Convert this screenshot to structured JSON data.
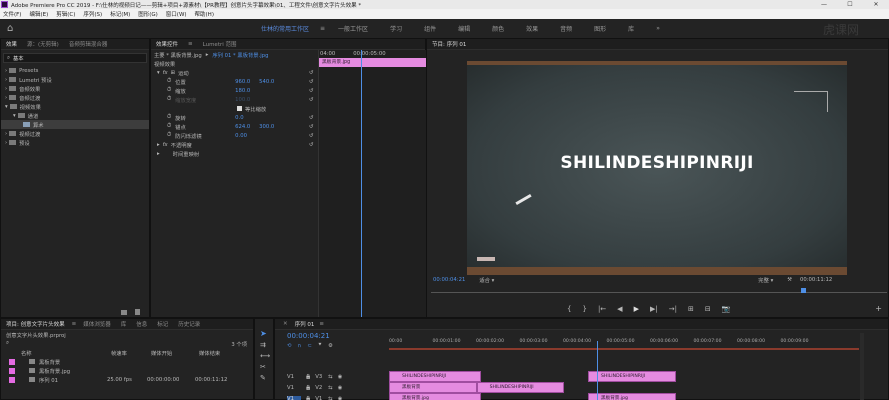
{
  "app": {
    "title": "Adobe Premiere Pro CC 2019 - F:\\仕林的视频日记——剪辑+项目+源素材\\【PR教程】创意片头字幕效果\\01、工程文件\\创意文字片头效果 *",
    "window_buttons": [
      "—",
      "☐",
      "✕"
    ]
  },
  "menu": [
    "文件(F)",
    "编辑(E)",
    "剪辑(C)",
    "序列(S)",
    "标记(M)",
    "图形(G)",
    "窗口(W)",
    "帮助(H)"
  ],
  "workspaces": [
    "仕林的常用工作区",
    "≡",
    "一般工作区",
    "学习",
    "组件",
    "编辑",
    "颜色",
    "效果",
    "音频",
    "图形",
    "库",
    "»"
  ],
  "effects_panel": {
    "tabs": [
      "效果",
      "源：(无剪辑)",
      "音频剪辑混合器"
    ],
    "search_value": "基本",
    "tree": [
      {
        "label": "Presets",
        "indent": 0,
        "icon": "folder",
        "selected": false
      },
      {
        "label": "Lumetri 预设",
        "indent": 0,
        "icon": "folder",
        "selected": false
      },
      {
        "label": "音频效果",
        "indent": 0,
        "icon": "folder",
        "selected": false
      },
      {
        "label": "音频过渡",
        "indent": 0,
        "icon": "folder",
        "selected": false
      },
      {
        "label": "视频效果",
        "indent": 0,
        "icon": "folder",
        "selected": false,
        "open": true
      },
      {
        "label": "通道",
        "indent": 1,
        "icon": "folder",
        "selected": false,
        "open": true
      },
      {
        "label": "算术",
        "indent": 2,
        "icon": "fx",
        "selected": true
      },
      {
        "label": "视频过渡",
        "indent": 0,
        "icon": "folder",
        "selected": false
      },
      {
        "label": "预设",
        "indent": 0,
        "icon": "folder",
        "selected": false
      }
    ]
  },
  "effect_controls": {
    "tabs": [
      "效果控件",
      "≡",
      "Lumetri 范围"
    ],
    "breadcrumb_master": "主要 * 黑板背景.jpg",
    "breadcrumb_seq": "序列 01 * 黑板背景.jpg",
    "mini_clip": "黑板背景.jpg",
    "mini_time_start": "04:00",
    "mini_time_end": "00:00:05:00",
    "section_video": "视频效果",
    "motion_label": "运动",
    "rows": [
      {
        "label": "位置",
        "v1": "960.0",
        "v2": "540.0"
      },
      {
        "label": "缩放",
        "v1": "180.0",
        "v2": ""
      },
      {
        "label": "缩放宽度",
        "v1": "100.0",
        "v2": "",
        "dim": true
      },
      {
        "label": "等比缩放",
        "checkbox": true
      },
      {
        "label": "旋转",
        "v1": "0.0",
        "v2": ""
      },
      {
        "label": "锚点",
        "v1": "624.0",
        "v2": "300.0"
      },
      {
        "label": "防闪烁滤镜",
        "v1": "0.00",
        "v2": ""
      }
    ],
    "opacity_label": "不透明度",
    "timeremap_label": "时间重映射"
  },
  "program_monitor": {
    "title": "节目: 序列 01",
    "canvas_text": "SHILINDESHIPINRIJI",
    "timecode": "00:00:04:21",
    "fit_label": "适合",
    "quality_label": "完整",
    "duration": "00:00:11:12",
    "controls": [
      "{",
      "}",
      "|←",
      "◀",
      "▶",
      "▶|",
      "→|",
      "⊞",
      "⊟",
      "📷",
      "+"
    ]
  },
  "project_panel": {
    "tabs": [
      "项目: 创意文字片头效果",
      "≡",
      "媒体浏览器",
      "库",
      "信息",
      "标记",
      "历史记录"
    ],
    "project_file": "创意文字片头效果.prproj",
    "item_count": "3 个项",
    "columns": [
      "名称",
      "帧速率",
      "媒体开始",
      "媒体结束"
    ],
    "items": [
      {
        "name": "黑板背景",
        "fps": "",
        "start": "",
        "end": ""
      },
      {
        "name": "黑板背景.jpg",
        "fps": "",
        "start": "",
        "end": ""
      },
      {
        "name": "序列 01",
        "fps": "25.00 fps",
        "start": "00:00:00:00",
        "end": "00:00:11:12"
      }
    ]
  },
  "timeline": {
    "tab_label": "序列 01",
    "timecode": "00:00:04:21",
    "ruler": [
      "00:00",
      "00:00:01:00",
      "00:00:02:00",
      "00:00:03:00",
      "00:00:04:00",
      "00:00:05:00",
      "00:00:06:00",
      "00:00:07:00",
      "00:00:08:00",
      "00:00:09:00"
    ],
    "tracks": [
      {
        "name": "V3",
        "id": "V1"
      },
      {
        "name": "V2",
        "id": "V1"
      },
      {
        "name": "V1",
        "id": "V1"
      }
    ],
    "clips": [
      {
        "label": "SHILINDESHIPINRIJI",
        "track": 0,
        "start": 0,
        "len": 1.15
      },
      {
        "label": "SHILINDESHIPINRIJI",
        "track": 0,
        "start": 2.5,
        "len": 1.1
      },
      {
        "label": "黑板背景",
        "track": 1,
        "start": 0,
        "len": 1.1
      },
      {
        "label": "SHILINDESHIPINRIJI",
        "track": 1,
        "start": 1.1,
        "len": 1.1
      },
      {
        "label": "黑板背景.jpg",
        "track": 2,
        "start": 0,
        "len": 1.15
      },
      {
        "label": "黑板背景.jpg",
        "track": 2,
        "start": 2.5,
        "len": 1.1
      }
    ]
  },
  "colors": {
    "accent_blue": "#4e8fe6",
    "clip_pink": "#e58be0",
    "panel_bg": "#232323",
    "chalkboard": "#3b4446"
  },
  "watermark": "虎课网"
}
